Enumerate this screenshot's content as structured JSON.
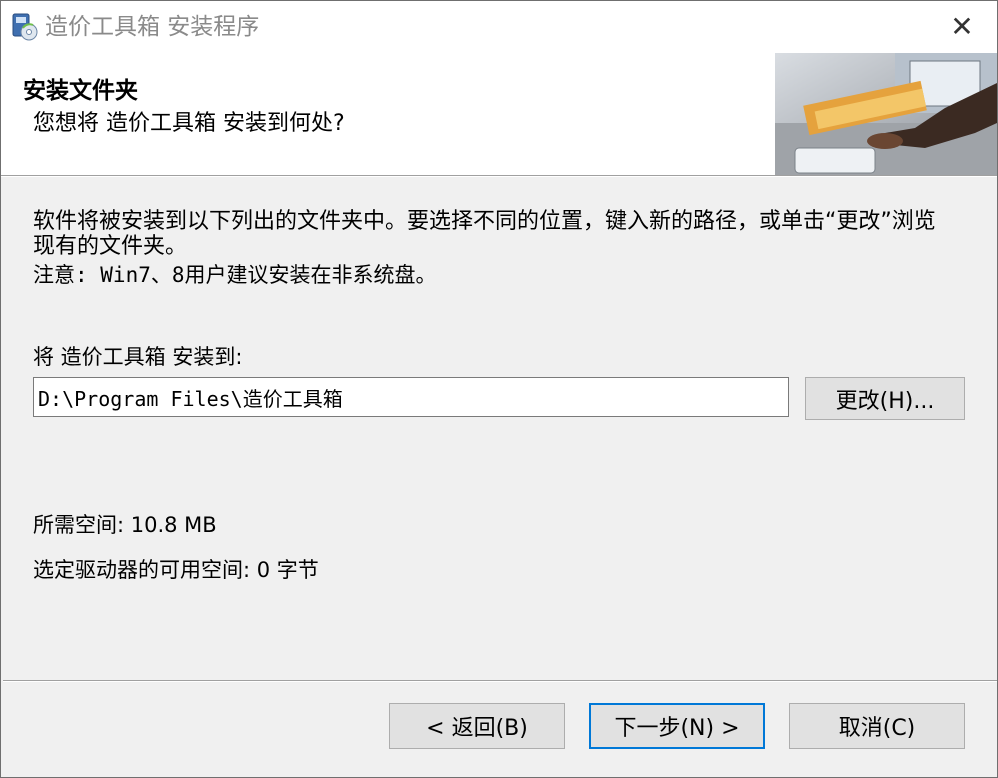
{
  "window": {
    "title": "造价工具箱 安装程序",
    "close_label": "✕"
  },
  "header": {
    "title": "安装文件夹",
    "subtitle": "您想将 造价工具箱 安装到何处?"
  },
  "body": {
    "description": "软件将被安装到以下列出的文件夹中。要选择不同的位置，键入新的路径，或单击“更改”浏览现有的文件夹。",
    "note": "注意: Win7、8用户建议安装在非系统盘。",
    "install_to_label": "将 造价工具箱 安装到:",
    "install_path": "D:\\Program Files\\造价工具箱",
    "change_button": "更改(H)...",
    "space_required": "所需空间: 10.8 MB",
    "space_available": "选定驱动器的可用空间: 0 字节"
  },
  "footer": {
    "back_button": "< 返回(B)",
    "next_button": "下一步(N) >",
    "cancel_button": "取消(C)"
  },
  "colors": {
    "focus_border": "#0078d7",
    "dialog_bg": "#f0f0f0",
    "header_bg": "#ffffff"
  },
  "icons": {
    "app": "installer-disc-icon",
    "close": "close-icon",
    "header_image": "person-at-desk-photo"
  }
}
